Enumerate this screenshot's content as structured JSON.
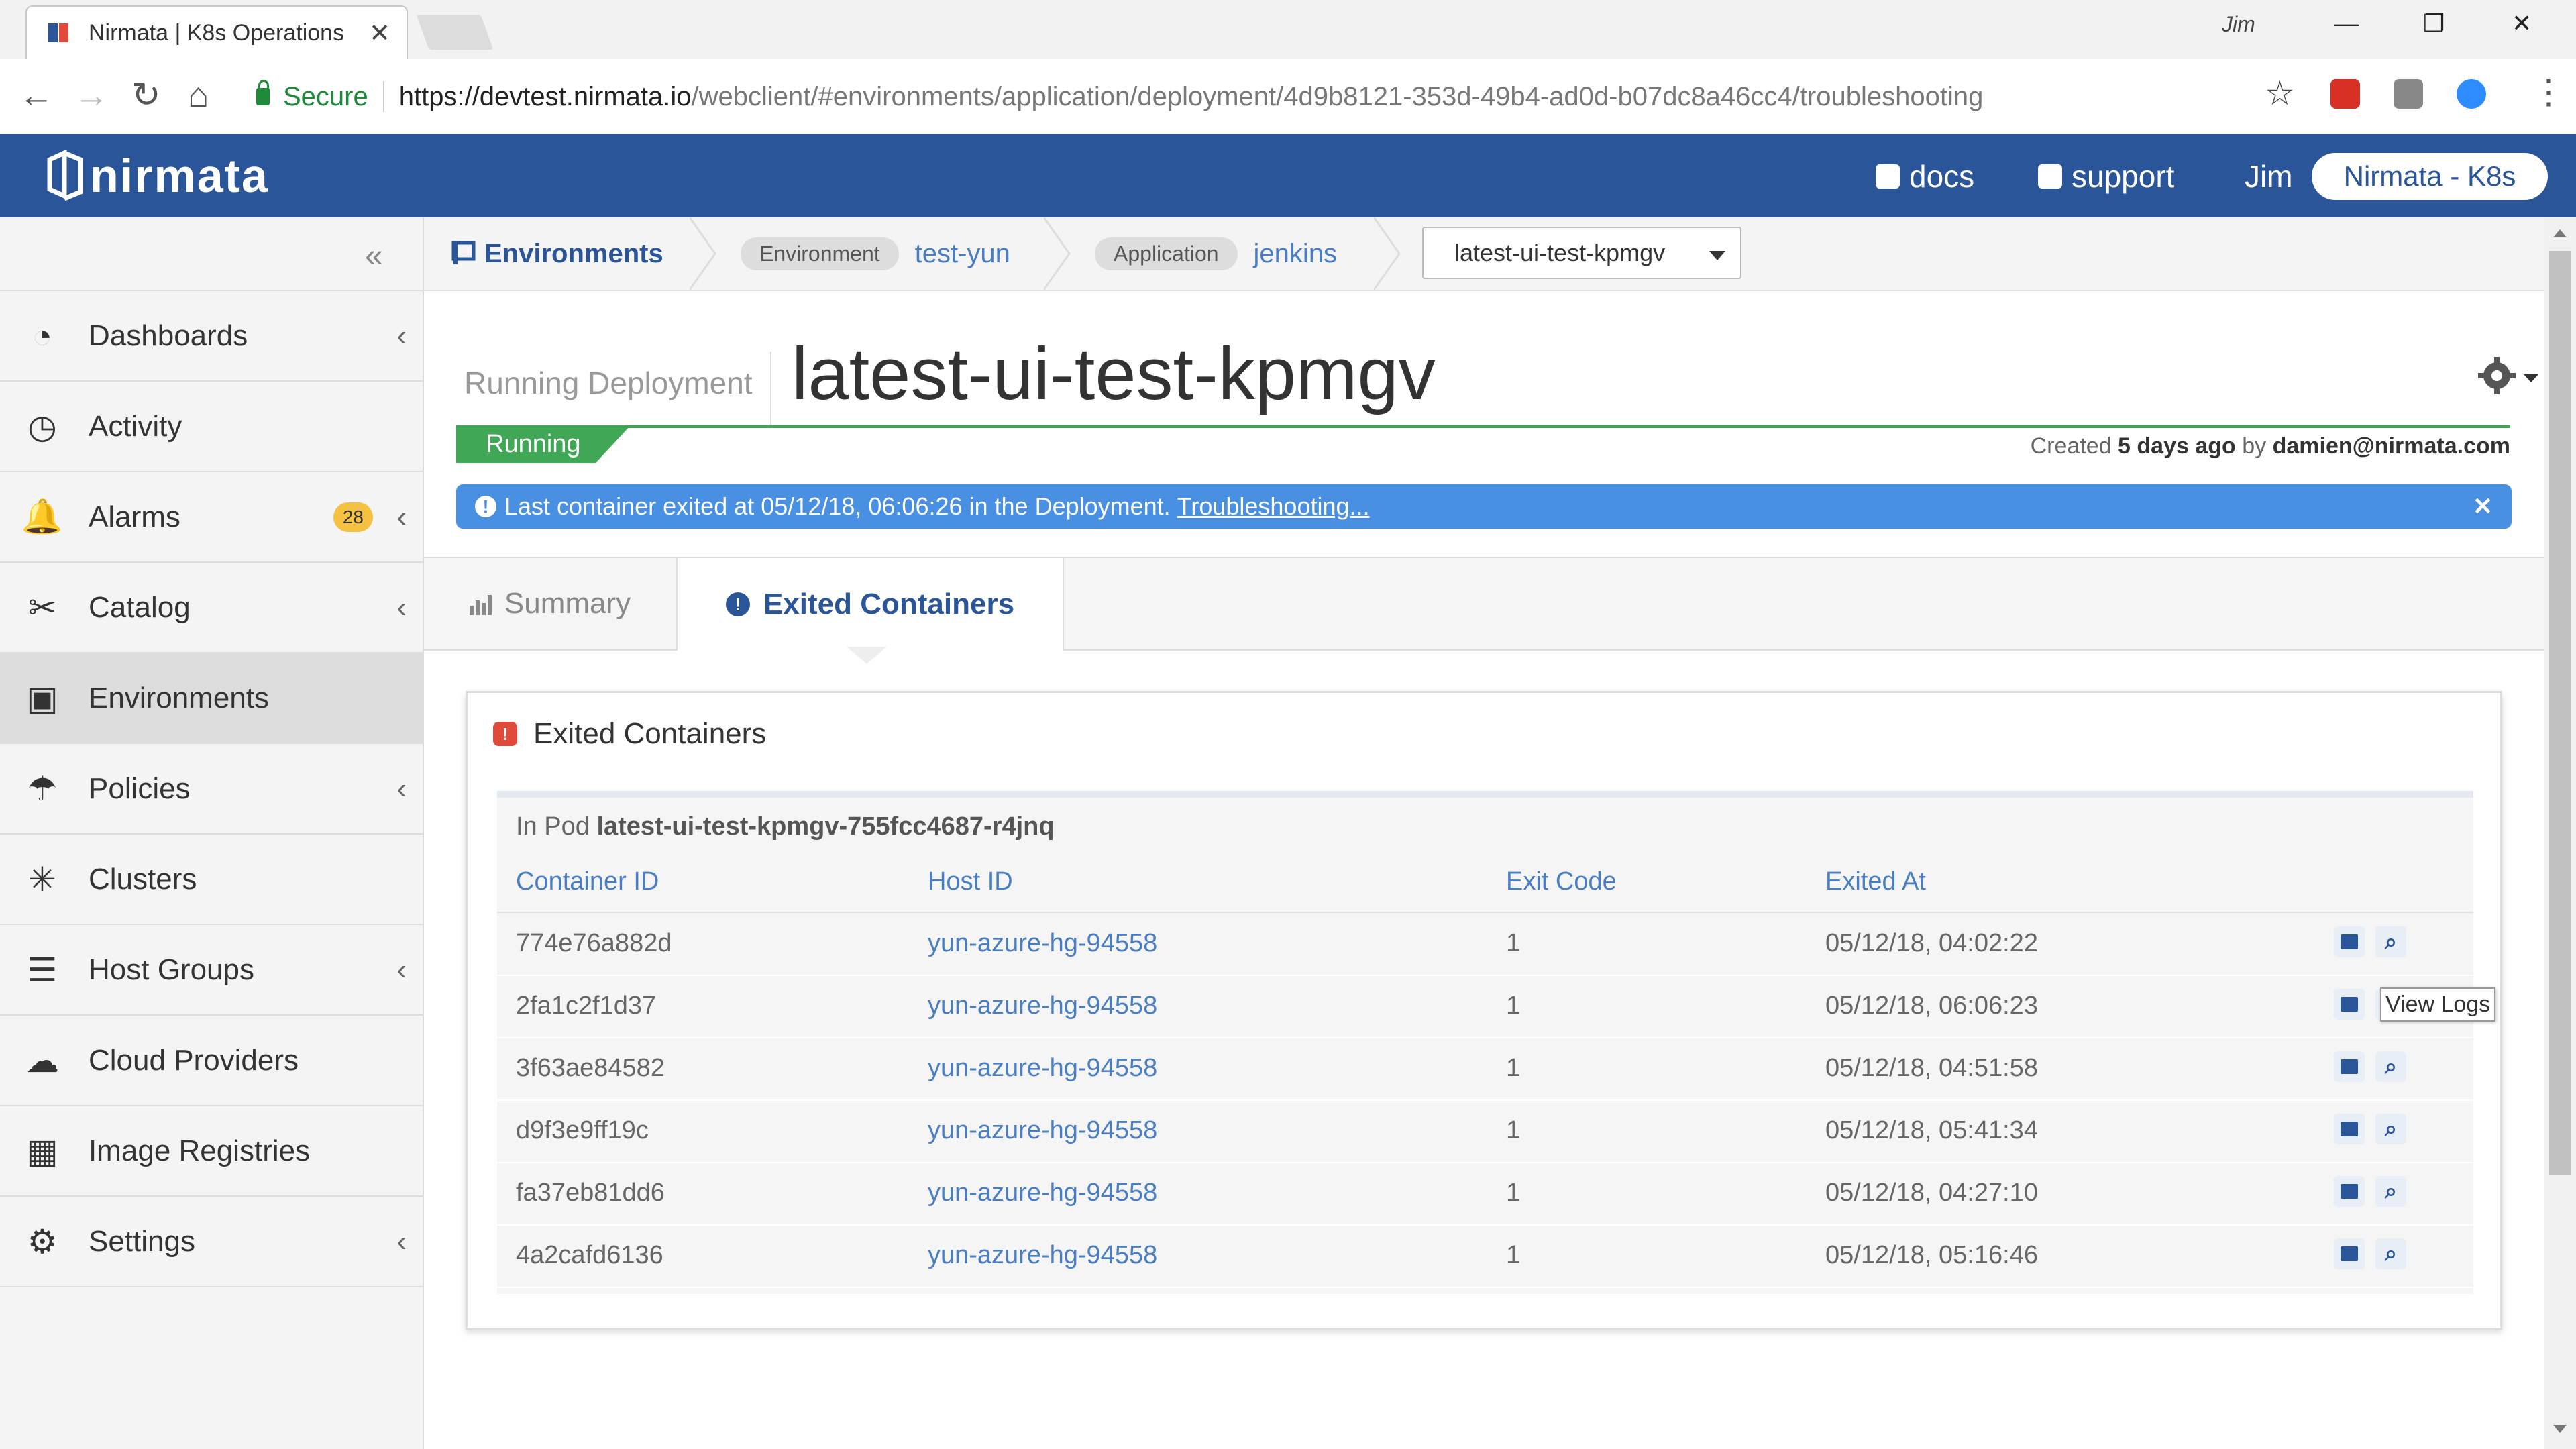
{
  "browser": {
    "tab_title": "Nirmata | K8s Operations",
    "close_glyph": "✕",
    "window_user": "Jim",
    "secure_label": "Secure",
    "url_host": "https://devtest.nirmata.io",
    "url_path": "/webclient/#environments/application/deployment/4d9b8121-353d-49b4-ad0d-b07dc8a46cc4/troubleshooting"
  },
  "header": {
    "brand": "nirmata",
    "docs": "docs",
    "support": "support",
    "user": "Jim",
    "tenant": "Nirmata - K8s",
    "brand_color": "#2a5699"
  },
  "sidebar": {
    "collapse_glyph": "«",
    "items": [
      {
        "label": "Dashboards",
        "icon": "dashboard-icon",
        "chevron": "‹"
      },
      {
        "label": "Activity",
        "icon": "activity-icon"
      },
      {
        "label": "Alarms",
        "icon": "bell-icon",
        "badge": "28",
        "chevron": "‹"
      },
      {
        "label": "Catalog",
        "icon": "tools-icon",
        "chevron": "‹"
      },
      {
        "label": "Environments",
        "icon": "environment-icon",
        "active": true
      },
      {
        "label": "Policies",
        "icon": "umbrella-icon",
        "chevron": "‹"
      },
      {
        "label": "Clusters",
        "icon": "cluster-icon"
      },
      {
        "label": "Host Groups",
        "icon": "server-icon",
        "chevron": "‹"
      },
      {
        "label": "Cloud Providers",
        "icon": "cloud-icon"
      },
      {
        "label": "Image Registries",
        "icon": "registry-icon"
      },
      {
        "label": "Settings",
        "icon": "gear-icon",
        "chevron": "‹"
      }
    ]
  },
  "breadcrumb": {
    "root": "Environments",
    "env_pill": "Environment",
    "env_value": "test-yun",
    "app_pill": "Application",
    "app_value": "jenkins",
    "deployment_select": "latest-ui-test-kpmgv"
  },
  "deployment": {
    "kind_label": "Running Deployment",
    "name": "latest-ui-test-kpmgv",
    "status": "Running",
    "status_color": "#3fa756",
    "created_prefix": "Created",
    "created_when": "5 days ago",
    "created_by_prefix": "by",
    "created_by": "damien@nirmata.com"
  },
  "alert": {
    "text": "Last container exited at 05/12/18, 06:06:26 in the Deployment.",
    "link": "Troubleshooting...",
    "info_glyph": "!",
    "close_glyph": "✕"
  },
  "tabs": {
    "summary": "Summary",
    "exited": "Exited Containers",
    "info_glyph": "!"
  },
  "panel": {
    "title": "Exited Containers",
    "error_glyph": "!",
    "pod_prefix": "In Pod",
    "pod_name": "latest-ui-test-kpmgv-755fcc4687-r4jnq",
    "columns": [
      "Container ID",
      "Host ID",
      "Exit Code",
      "Exited At"
    ],
    "rows": [
      {
        "container_id": "774e76a882d",
        "host_id": "yun-azure-hg-94558",
        "exit_code": "1",
        "exited_at": "05/12/18, 04:02:22"
      },
      {
        "container_id": "2fa1c2f1d37",
        "host_id": "yun-azure-hg-94558",
        "exit_code": "1",
        "exited_at": "05/12/18, 06:06:23"
      },
      {
        "container_id": "3f63ae84582",
        "host_id": "yun-azure-hg-94558",
        "exit_code": "1",
        "exited_at": "05/12/18, 04:51:58"
      },
      {
        "container_id": "d9f3e9ff19c",
        "host_id": "yun-azure-hg-94558",
        "exit_code": "1",
        "exited_at": "05/12/18, 05:41:34"
      },
      {
        "container_id": "fa37eb81dd6",
        "host_id": "yun-azure-hg-94558",
        "exit_code": "1",
        "exited_at": "05/12/18, 04:27:10"
      },
      {
        "container_id": "4a2cafd6136",
        "host_id": "yun-azure-hg-94558",
        "exit_code": "1",
        "exited_at": "05/12/18, 05:16:46"
      }
    ],
    "tooltip": "View Logs",
    "zoom_glyph": "⌕"
  }
}
